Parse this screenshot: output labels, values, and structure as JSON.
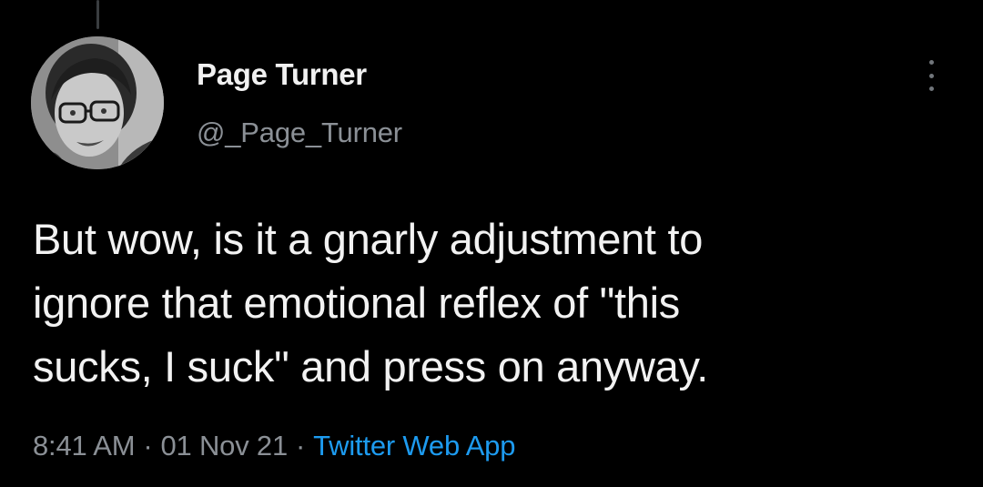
{
  "author": {
    "display_name": "Page Turner",
    "handle": "@_Page_Turner",
    "avatar_icon": "profile-photo"
  },
  "tweet": {
    "lines": [
      "But wow, is it a gnarly adjustment to",
      "ignore that emotional reflex of \"this",
      "sucks, I suck\" and press on anyway."
    ],
    "time": "8:41 AM",
    "separator": "·",
    "date": "01 Nov 21",
    "source": "Twitter Web App"
  },
  "colors": {
    "background": "#000000",
    "text": "#e7e9ea",
    "secondary": "#8b9096",
    "link": "#1d9bf0"
  },
  "icons": {
    "more": "more-options-vertical-icon"
  }
}
